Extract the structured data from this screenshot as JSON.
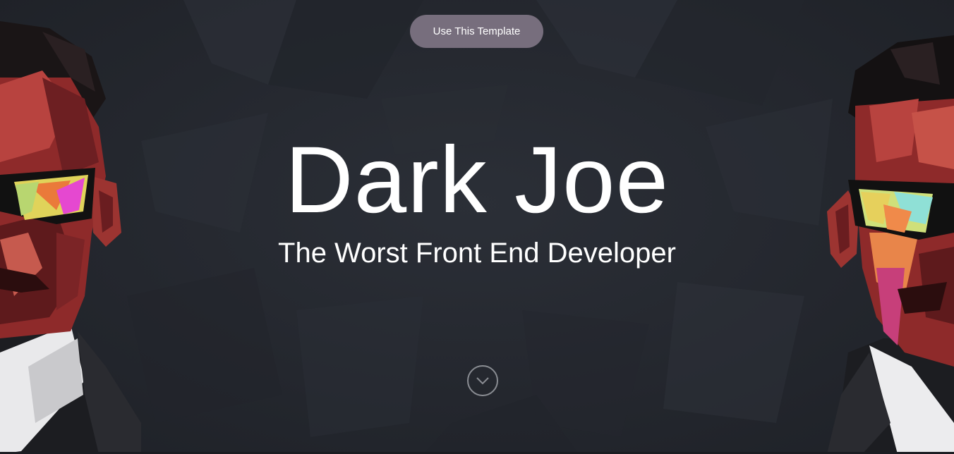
{
  "cta": {
    "label": "Use This Template"
  },
  "hero": {
    "title": "Dark Joe",
    "subtitle": "The Worst Front End Developer"
  },
  "icons": {
    "scroll": "chevron-down-icon"
  },
  "colors": {
    "background": "#262a31",
    "cta_background": "#776e7d",
    "text": "#ffffff",
    "scroll_ring": "#8a8d93"
  }
}
